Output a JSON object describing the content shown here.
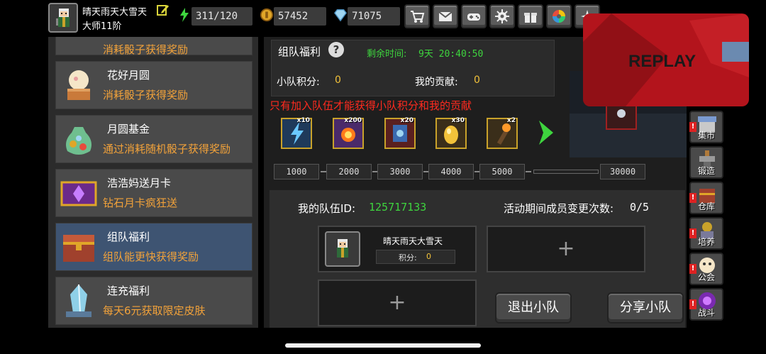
{
  "player": {
    "name": "晴天雨天大雪天",
    "rank": "大师11阶"
  },
  "stats": {
    "energy": "311/120",
    "gold": "57452",
    "gems": "71075"
  },
  "left_list": {
    "partial_item_desc": "消耗骰子获得奖励",
    "items": [
      {
        "title": "花好月圆",
        "desc": "消耗骰子获得奖励"
      },
      {
        "title": "月圆基金",
        "desc": "通过消耗随机骰子获得奖励"
      },
      {
        "title": "浩浩妈送月卡",
        "desc": "钻石月卡疯狂送"
      },
      {
        "title": "组队福利",
        "desc": "组队能更快获得奖励"
      },
      {
        "title": "连充福利",
        "desc": "每天6元获取限定皮肤"
      }
    ]
  },
  "team_event": {
    "title": "组队福利",
    "help": "?",
    "remaining_label": "剩余时间:",
    "remaining_time": "9天 20:40:50",
    "score_label": "小队积分:",
    "score_value": "0",
    "contribution_label": "我的贡献:",
    "contribution_value": "0",
    "warning": "只有加入队伍才能获得小队积分和我的贡献",
    "rewards": [
      {
        "icon": "lightning-icon",
        "qty": "x10"
      },
      {
        "icon": "fire-orb-icon",
        "qty": "x200"
      },
      {
        "icon": "blue-scroll-icon",
        "qty": "x20"
      },
      {
        "icon": "golden-egg-icon",
        "qty": "x30"
      },
      {
        "icon": "torch-icon",
        "qty": "x2"
      }
    ],
    "milestones": [
      "1000",
      "2000",
      "3000",
      "4000",
      "5000",
      "30000"
    ],
    "progress": 0
  },
  "team": {
    "id_label": "我的队伍ID:",
    "id_value": "125717133",
    "changes_label": "活动期间成员变更次数:",
    "changes_value": "0/5",
    "member": {
      "name": "晴天雨天大雪天",
      "score_label": "积分:",
      "score_value": "0"
    },
    "add_slot": "+",
    "leave_button": "退出小队",
    "share_button": "分享小队"
  },
  "side_menu": [
    "集市",
    "锻造",
    "仓库",
    "培养",
    "公会",
    "战斗"
  ],
  "side_alert": "!",
  "replay": {
    "label": "REPLAY"
  },
  "colors": {
    "accent_green": "#3ed43e",
    "accent_orange": "#f2a23a",
    "warning_red": "#ff2a1f",
    "active_item": "#3e5472"
  }
}
